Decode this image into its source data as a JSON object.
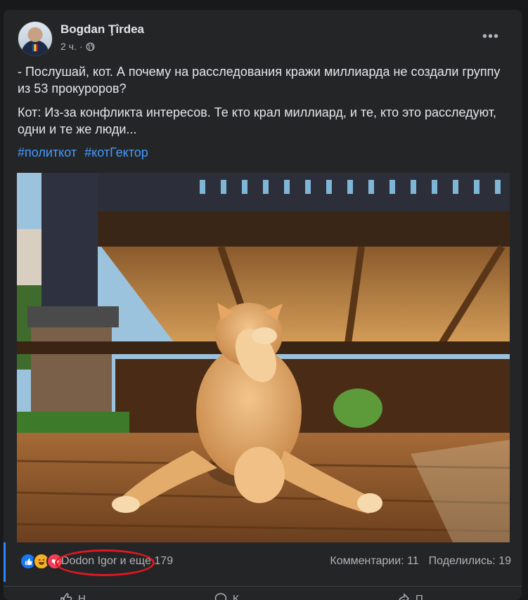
{
  "post": {
    "author": "Bogdan Ţîrdea",
    "time": "2 ч.",
    "separator": "·",
    "paragraph1": "- Послушай, кот. А почему на расследования кражи миллиарда не создали группу из 53 прокуроров?",
    "paragraph2": "Кот:  Из-за конфликта интересов. Те кто крал миллиард, и те, кто это расследуют, одни и те же люди...",
    "hashtags": [
      "#политкот",
      "#котГектор"
    ],
    "more_label": "•••"
  },
  "footer": {
    "reaction_names": "Dodon Igor и ещё 179",
    "comments": "Комментарии: 11",
    "shares": "Поделились: 19"
  },
  "actions": {
    "like": "Н",
    "comment": "К",
    "share": "П"
  },
  "colors": {
    "card": "#242526",
    "accent": "#2d88ff",
    "hashtag": "#4599ff",
    "highlight": "#e01822"
  }
}
